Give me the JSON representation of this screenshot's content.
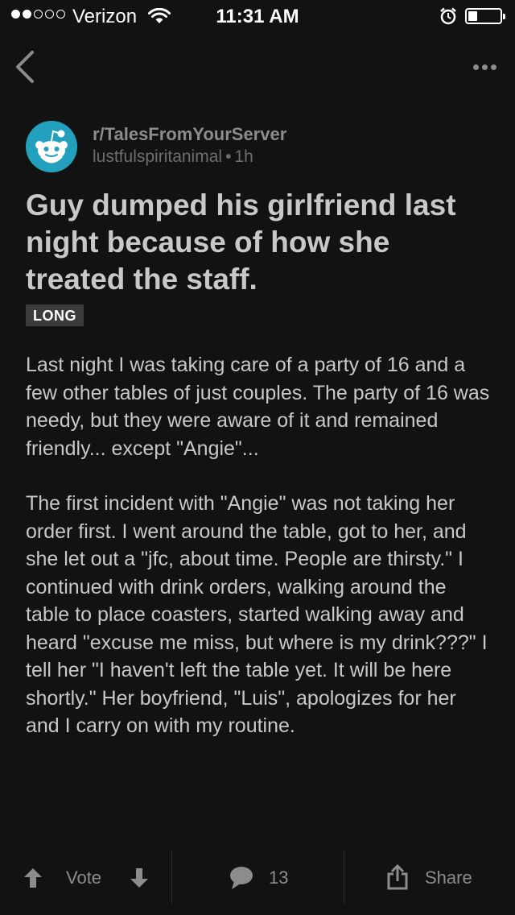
{
  "status_bar": {
    "carrier": "Verizon",
    "time": "11:31 AM",
    "signal_bars_filled": 2,
    "signal_bars_total": 5,
    "battery_level": 0.3,
    "icons": [
      "wifi-icon",
      "alarm-icon",
      "battery-icon"
    ]
  },
  "nav": {
    "icons": [
      "back-chevron-icon",
      "more-options-icon"
    ]
  },
  "post": {
    "subreddit": "r/TalesFromYourServer",
    "author": "lustfulspiritanimal",
    "separator": "•",
    "age": "1h",
    "title": "Guy dumped his girlfriend last night because of how she treated the staff.",
    "flair": "LONG",
    "body": [
      "Last night I was taking care of a party of 16 and a few other tables of just couples. The party of 16 was needy, but they were aware of it and remained friendly... except \"Angie\"...",
      "The first incident with \"Angie\" was not taking her order first. I went around the table, got to her, and she let out a \"jfc, about time. People are thirsty.\" I continued with drink orders, walking around the table to place coasters, started walking away and heard \"excuse me miss, but where is my drink???\" I tell her \"I haven't left the table yet. It will be here shortly.\" Her boyfriend, \"Luis\", apologizes for her and I carry on with my routine."
    ]
  },
  "actions": {
    "vote_label": "Vote",
    "comment_count": "13",
    "share_label": "Share",
    "icons": [
      "upvote-icon",
      "downvote-icon",
      "comment-icon",
      "share-icon"
    ]
  },
  "colors": {
    "background": "#121212",
    "text_primary": "#c8c8c8",
    "text_muted": "#8c8c8c",
    "avatar": "#24a0bf",
    "flair_background": "#3b3b3b"
  }
}
